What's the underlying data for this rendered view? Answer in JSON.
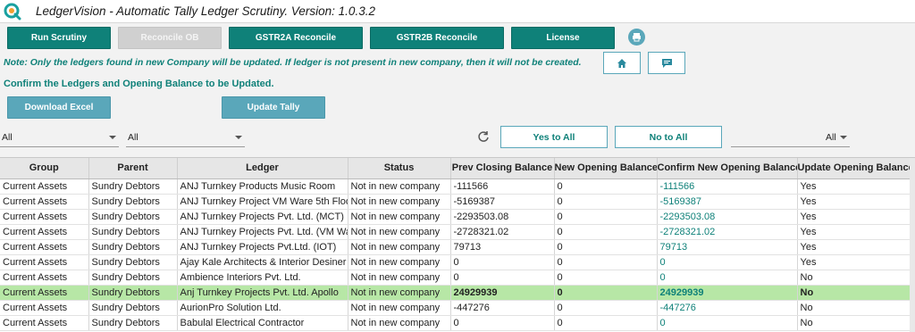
{
  "window": {
    "title": "LedgerVision - Automatic Tally Ledger Scrutiny.  Version: 1.0.3.2"
  },
  "toolbar": {
    "run_scrutiny": "Run Scrutiny",
    "reconcile_ob": "Reconcile OB",
    "gstr2a": "GSTR2A Reconcile",
    "gstr2b": "GSTR2B Reconcile",
    "license": "License"
  },
  "note": "Note: Only the ledgers found in new Company will be updated. If ledger is not present in new company, then it will not be created.",
  "confirm_text": "Confirm the Ledgers and Opening Balance to be Updated.",
  "actions": {
    "download_excel": "Download Excel",
    "update_tally": "Update Tally"
  },
  "filters": {
    "group": "All",
    "parent": "All",
    "update": "All"
  },
  "bulk": {
    "yes_to_all": "Yes to All",
    "no_to_all": "No to All"
  },
  "table": {
    "columns": [
      "Group",
      "Parent",
      "Ledger",
      "Status",
      "Prev Closing Balance",
      "New Opening Balance",
      "Confirm New Opening Balance",
      "Update Opening Balance"
    ],
    "rows": [
      [
        "Current Assets",
        "Sundry Debtors",
        "ANJ Turnkey Products Music Room",
        "Not in new company",
        "-111566",
        "0",
        "-111566",
        "Yes"
      ],
      [
        "Current Assets",
        "Sundry Debtors",
        "ANJ Turnkey Project VM Ware 5th Floo",
        "Not in new company",
        "-5169387",
        "0",
        "-5169387",
        "Yes"
      ],
      [
        "Current Assets",
        "Sundry Debtors",
        "ANJ Turnkey Projects Pvt. Ltd. (MCT)",
        "Not in new company",
        "-2293503.08",
        "0",
        "-2293503.08",
        "Yes"
      ],
      [
        "Current Assets",
        "Sundry Debtors",
        "ANJ Turnkey Projects Pvt. Ltd. (VM Wa",
        "Not in new company",
        "-2728321.02",
        "0",
        "-2728321.02",
        "Yes"
      ],
      [
        "Current Assets",
        "Sundry Debtors",
        "ANJ Turnkey Projects Pvt.Ltd. (IOT)",
        "Not in new company",
        "79713",
        "0",
        "79713",
        "Yes"
      ],
      [
        "Current Assets",
        "Sundry Debtors",
        "Ajay Kale Architects & Interior Desiner",
        "Not in new company",
        "0",
        "0",
        "0",
        "Yes"
      ],
      [
        "Current Assets",
        "Sundry Debtors",
        "Ambience Interiors Pvt. Ltd.",
        "Not in new company",
        "0",
        "0",
        "0",
        "No"
      ],
      [
        "Current Assets",
        "Sundry Debtors",
        "Anj Turnkey Projects Pvt. Ltd. Apollo",
        "Not in new company",
        "24929939",
        "0",
        "24929939",
        "No"
      ],
      [
        "Current Assets",
        "Sundry Debtors",
        "AurionPro Solution Ltd.",
        "Not in new company",
        "-447276",
        "0",
        "-447276",
        "No"
      ],
      [
        "Current Assets",
        "Sundry Debtors",
        "Babulal Electrical Contractor",
        "Not in new company",
        "0",
        "0",
        "0",
        "No"
      ]
    ],
    "selected_row": 7
  }
}
